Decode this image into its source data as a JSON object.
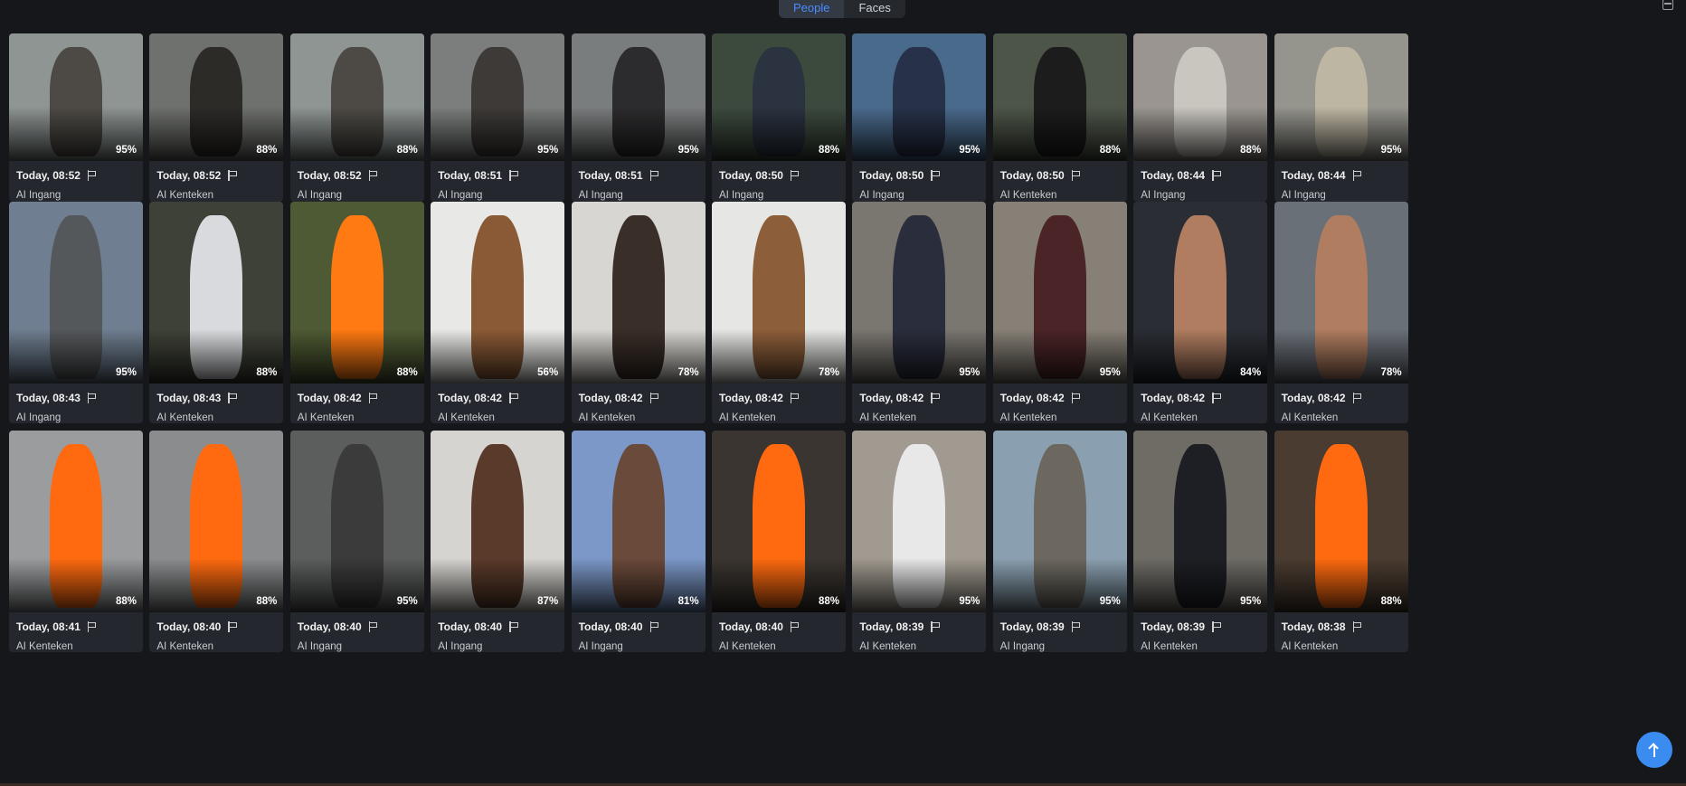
{
  "tabs": [
    {
      "label": "People",
      "active": true
    },
    {
      "label": "Faces",
      "active": false
    }
  ],
  "accent": "#4a8cff",
  "rows": [
    [
      {
        "time": "Today, 08:52",
        "camera": "AI Ingang",
        "score": "95%",
        "bg": "#8e9593",
        "fg": "#4d4a45"
      },
      {
        "time": "Today, 08:52",
        "camera": "AI Kenteken",
        "score": "88%",
        "bg": "#6f716e",
        "fg": "#2d2b28"
      },
      {
        "time": "Today, 08:52",
        "camera": "AI Ingang",
        "score": "88%",
        "bg": "#8e9593",
        "fg": "#4d4a45"
      },
      {
        "time": "Today, 08:51",
        "camera": "AI Ingang",
        "score": "95%",
        "bg": "#7b7e7c",
        "fg": "#3d3a38"
      },
      {
        "time": "Today, 08:51",
        "camera": "AI Ingang",
        "score": "95%",
        "bg": "#7a7d7e",
        "fg": "#2c2c2e"
      },
      {
        "time": "Today, 08:50",
        "camera": "AI Ingang",
        "score": "88%",
        "bg": "#3c4a3e",
        "fg": "#2b3340"
      },
      {
        "time": "Today, 08:50",
        "camera": "AI Ingang",
        "score": "95%",
        "bg": "#4a6a8c",
        "fg": "#27324a"
      },
      {
        "time": "Today, 08:50",
        "camera": "AI Kenteken",
        "score": "88%",
        "bg": "#4d5548",
        "fg": "#1c1c1c"
      },
      {
        "time": "Today, 08:44",
        "camera": "AI Ingang",
        "score": "88%",
        "bg": "#9a9590",
        "fg": "#c9c6c0"
      },
      {
        "time": "Today, 08:44",
        "camera": "AI Ingang",
        "score": "95%",
        "bg": "#95948d",
        "fg": "#bdb6a3"
      }
    ],
    [
      {
        "time": "Today, 08:43",
        "camera": "AI Ingang",
        "score": "95%",
        "bg": "#6f7e90",
        "fg": "#55585b"
      },
      {
        "time": "Today, 08:43",
        "camera": "AI Kenteken",
        "score": "88%",
        "bg": "#3e4137",
        "fg": "#d8dadd"
      },
      {
        "time": "Today, 08:42",
        "camera": "AI Kenteken",
        "score": "88%",
        "bg": "#4e5a33",
        "fg": "#ff7a12"
      },
      {
        "time": "Today, 08:42",
        "camera": "AI Kenteken",
        "score": "56%",
        "bg": "#e8e8e6",
        "fg": "#8a5a36"
      },
      {
        "time": "Today, 08:42",
        "camera": "AI Kenteken",
        "score": "78%",
        "bg": "#d8d6d2",
        "fg": "#3a2e28"
      },
      {
        "time": "Today, 08:42",
        "camera": "AI Kenteken",
        "score": "78%",
        "bg": "#e6e6e4",
        "fg": "#8c5e3a"
      },
      {
        "time": "Today, 08:42",
        "camera": "AI Kenteken",
        "score": "95%",
        "bg": "#7a7670",
        "fg": "#2a2d3c"
      },
      {
        "time": "Today, 08:42",
        "camera": "AI Kenteken",
        "score": "95%",
        "bg": "#868076",
        "fg": "#4a2426"
      },
      {
        "time": "Today, 08:42",
        "camera": "AI Kenteken",
        "score": "84%",
        "bg": "#2a2d34",
        "fg": "#b07d60"
      },
      {
        "time": "Today, 08:42",
        "camera": "AI Kenteken",
        "score": "78%",
        "bg": "#6a7078",
        "fg": "#b07d60"
      }
    ],
    [
      {
        "time": "Today, 08:41",
        "camera": "AI Kenteken",
        "score": "88%",
        "bg": "#9a9c9e",
        "fg": "#ff6a10"
      },
      {
        "time": "Today, 08:40",
        "camera": "AI Kenteken",
        "score": "88%",
        "bg": "#8a8c8e",
        "fg": "#ff6a10"
      },
      {
        "time": "Today, 08:40",
        "camera": "AI Ingang",
        "score": "95%",
        "bg": "#5c5e5e",
        "fg": "#3b3b3b"
      },
      {
        "time": "Today, 08:40",
        "camera": "AI Ingang",
        "score": "87%",
        "bg": "#d6d4d0",
        "fg": "#5a3a2a"
      },
      {
        "time": "Today, 08:40",
        "camera": "AI Ingang",
        "score": "81%",
        "bg": "#7c98c8",
        "fg": "#6a4a3a"
      },
      {
        "time": "Today, 08:40",
        "camera": "AI Kenteken",
        "score": "88%",
        "bg": "#3a3530",
        "fg": "#ff6a10"
      },
      {
        "time": "Today, 08:39",
        "camera": "AI Kenteken",
        "score": "95%",
        "bg": "#a09a90",
        "fg": "#e8e8e8"
      },
      {
        "time": "Today, 08:39",
        "camera": "AI Ingang",
        "score": "95%",
        "bg": "#8aa0b0",
        "fg": "#6c6860"
      },
      {
        "time": "Today, 08:39",
        "camera": "AI Kenteken",
        "score": "95%",
        "bg": "#6f6c66",
        "fg": "#1e1f24"
      },
      {
        "time": "Today, 08:38",
        "camera": "AI Kenteken",
        "score": "88%",
        "bg": "#4a3c30",
        "fg": "#ff6a10"
      }
    ]
  ]
}
